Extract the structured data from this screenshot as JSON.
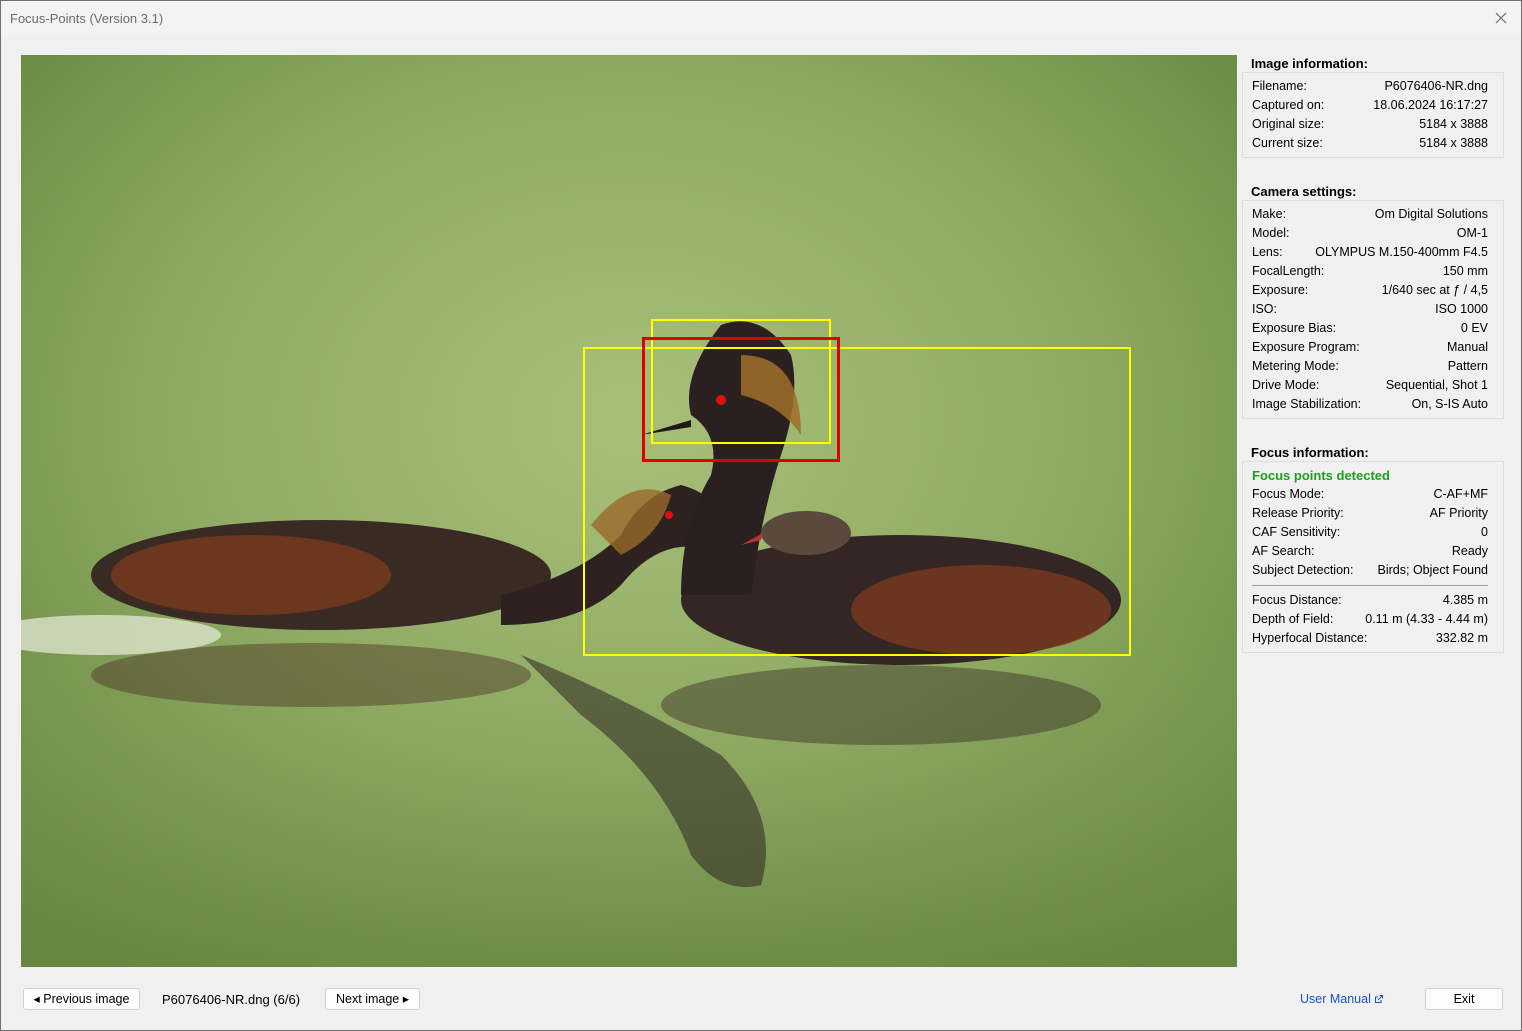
{
  "window": {
    "title": "Focus-Points (Version 3.1)"
  },
  "image_info": {
    "header": "Image information:",
    "rows": [
      {
        "label": "Filename:",
        "value": "P6076406-NR.dng"
      },
      {
        "label": "Captured on:",
        "value": "18.06.2024 16:17:27"
      },
      {
        "label": "Original size:",
        "value": "5184 x 3888"
      },
      {
        "label": "Current size:",
        "value": "5184 x 3888"
      }
    ]
  },
  "camera_settings": {
    "header": "Camera settings:",
    "rows": [
      {
        "label": "Make:",
        "value": "Om Digital Solutions"
      },
      {
        "label": "Model:",
        "value": "OM-1"
      },
      {
        "label": "Lens:",
        "value": "OLYMPUS M.150-400mm F4.5"
      },
      {
        "label": "FocalLength:",
        "value": "150 mm"
      },
      {
        "label": "Exposure:",
        "value": "1/640 sec at ƒ / 4,5"
      },
      {
        "label": "ISO:",
        "value": "ISO 1000"
      },
      {
        "label": "Exposure Bias:",
        "value": "0 EV"
      },
      {
        "label": "Exposure Program:",
        "value": "Manual"
      },
      {
        "label": "Metering Mode:",
        "value": "Pattern"
      },
      {
        "label": "Drive Mode:",
        "value": "Sequential, Shot 1"
      },
      {
        "label": "Image Stabilization:",
        "value": "On, S-IS Auto"
      }
    ]
  },
  "focus_info": {
    "header": "Focus information:",
    "status": "Focus points detected",
    "status_color": "#1e9e1e",
    "rows": [
      {
        "label": "Focus Mode:",
        "value": "C-AF+MF"
      },
      {
        "label": "Release Priority:",
        "value": "AF Priority"
      },
      {
        "label": "CAF Sensitivity:",
        "value": "0"
      },
      {
        "label": "AF Search:",
        "value": "Ready"
      },
      {
        "label": "Subject Detection:",
        "value": "Birds; Object Found"
      }
    ],
    "distance_rows": [
      {
        "label": "Focus Distance:",
        "value": "4.385 m"
      },
      {
        "label": "Depth of Field:",
        "value": "0.11 m (4.33 - 4.44 m)"
      },
      {
        "label": "Hyperfocal Distance:",
        "value": "332.82 m"
      }
    ]
  },
  "footer": {
    "prev_label": "◂ Previous image",
    "file_position": "P6076406-NR.dng (6/6)",
    "next_label": "Next image ▸",
    "manual_label": "User Manual",
    "exit_label": "Exit"
  },
  "colors": {
    "af_frame": "#ffff00",
    "af_active": "#e00000",
    "link": "#1a4fcc"
  },
  "icons": {
    "close": "close-icon",
    "external_link": "external-link-icon"
  }
}
